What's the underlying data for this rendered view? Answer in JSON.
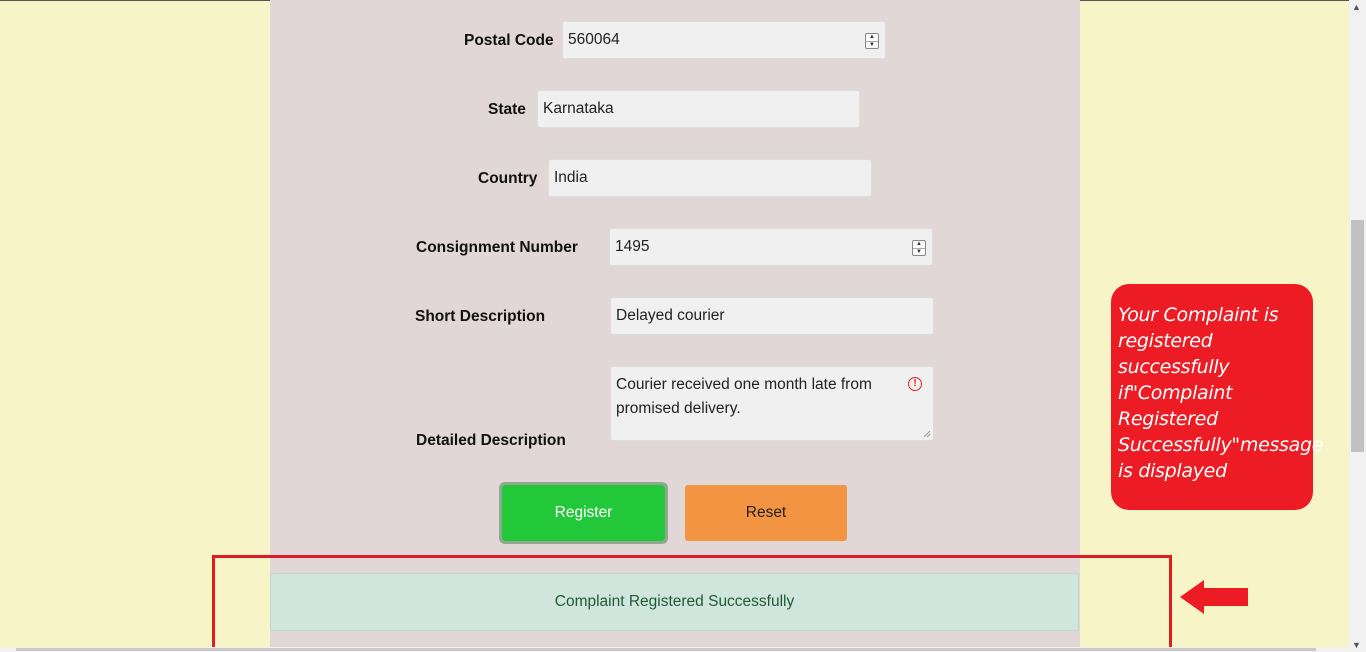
{
  "form": {
    "postal_code": {
      "label": "Postal Code",
      "value": "560064"
    },
    "state": {
      "label": "State",
      "value": "Karnataka"
    },
    "country": {
      "label": "Country",
      "value": "India"
    },
    "consignment": {
      "label": "Consignment Number",
      "value": "1495"
    },
    "short_description": {
      "label": "Short Description",
      "value": "Delayed courier"
    },
    "detailed_description": {
      "label": "Detailed Description",
      "value": "Courier received one month late from promised delivery."
    }
  },
  "buttons": {
    "register": "Register",
    "reset": "Reset"
  },
  "success_message": "Complaint Registered Successfully",
  "annotation": {
    "callout_text": "Your Complaint is registered successfully if\"Complaint Registered Successfully\"message is displayed",
    "callout_color": "#ed1c24"
  },
  "icons": {
    "warning": "warning-circle-icon",
    "arrow": "left-arrow-icon"
  }
}
